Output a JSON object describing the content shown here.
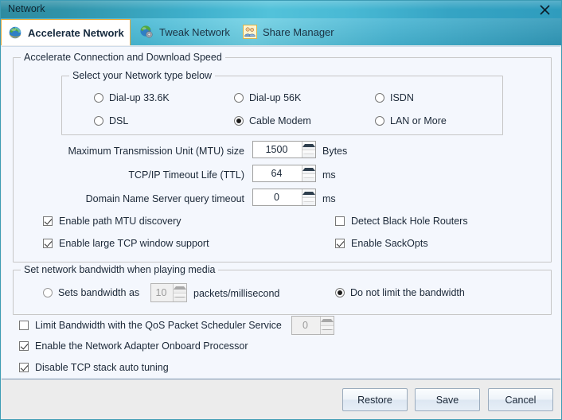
{
  "window": {
    "title": "Network",
    "close_icon": "close-icon"
  },
  "tabs": [
    {
      "label": "Accelerate Network",
      "icon": "globe-icon",
      "active": true
    },
    {
      "label": "Tweak Network",
      "icon": "globe-gear-icon",
      "active": false
    },
    {
      "label": "Share Manager",
      "icon": "users-icon",
      "active": false
    }
  ],
  "accelerate_group": {
    "title": "Accelerate Connection and Download Speed",
    "network_type_group": {
      "title": "Select your Network type below",
      "options": [
        {
          "label": "Dial-up 33.6K",
          "checked": false
        },
        {
          "label": "Dial-up 56K",
          "checked": false
        },
        {
          "label": "ISDN",
          "checked": false
        },
        {
          "label": "DSL",
          "checked": false
        },
        {
          "label": "Cable Modem",
          "checked": true
        },
        {
          "label": "LAN or More",
          "checked": false
        }
      ]
    },
    "fields": [
      {
        "label": "Maximum Transmission Unit (MTU) size",
        "value": "1500",
        "unit": "Bytes"
      },
      {
        "label": "TCP/IP Timeout Life (TTL)",
        "value": "64",
        "unit": "ms"
      },
      {
        "label": "Domain Name Server query timeout",
        "value": "0",
        "unit": "ms"
      }
    ],
    "checkboxes": [
      {
        "label": "Enable path MTU discovery",
        "checked": true
      },
      {
        "label": "Detect Black Hole Routers",
        "checked": false
      },
      {
        "label": "Enable large TCP window support",
        "checked": true
      },
      {
        "label": "Enable SackOpts",
        "checked": true
      }
    ]
  },
  "bandwidth_group": {
    "title": "Set network bandwidth when playing media",
    "sets_bandwidth": {
      "label": "Sets bandwidth as",
      "checked": false,
      "value": "10",
      "unit": "packets/millisecond",
      "disabled": true
    },
    "no_limit": {
      "label": "Do not limit the bandwidth",
      "checked": true
    }
  },
  "bottom_options": {
    "qos": {
      "label": "Limit Bandwidth with the QoS Packet Scheduler Service",
      "checked": false,
      "value": "0",
      "disabled": true
    },
    "onboard_processor": {
      "label": "Enable the Network Adapter Onboard Processor",
      "checked": true
    },
    "auto_tuning": {
      "label": "Disable TCP stack auto tuning",
      "checked": true
    }
  },
  "footer": {
    "restore_label": "Restore",
    "save_label": "Save",
    "cancel_label": "Cancel"
  },
  "colors": {
    "titlebar_accent": "#3fb0cc",
    "active_tab_border": "#e8a93a",
    "content_bg": "#f4f7fd",
    "footer_bg": "#ececec"
  }
}
